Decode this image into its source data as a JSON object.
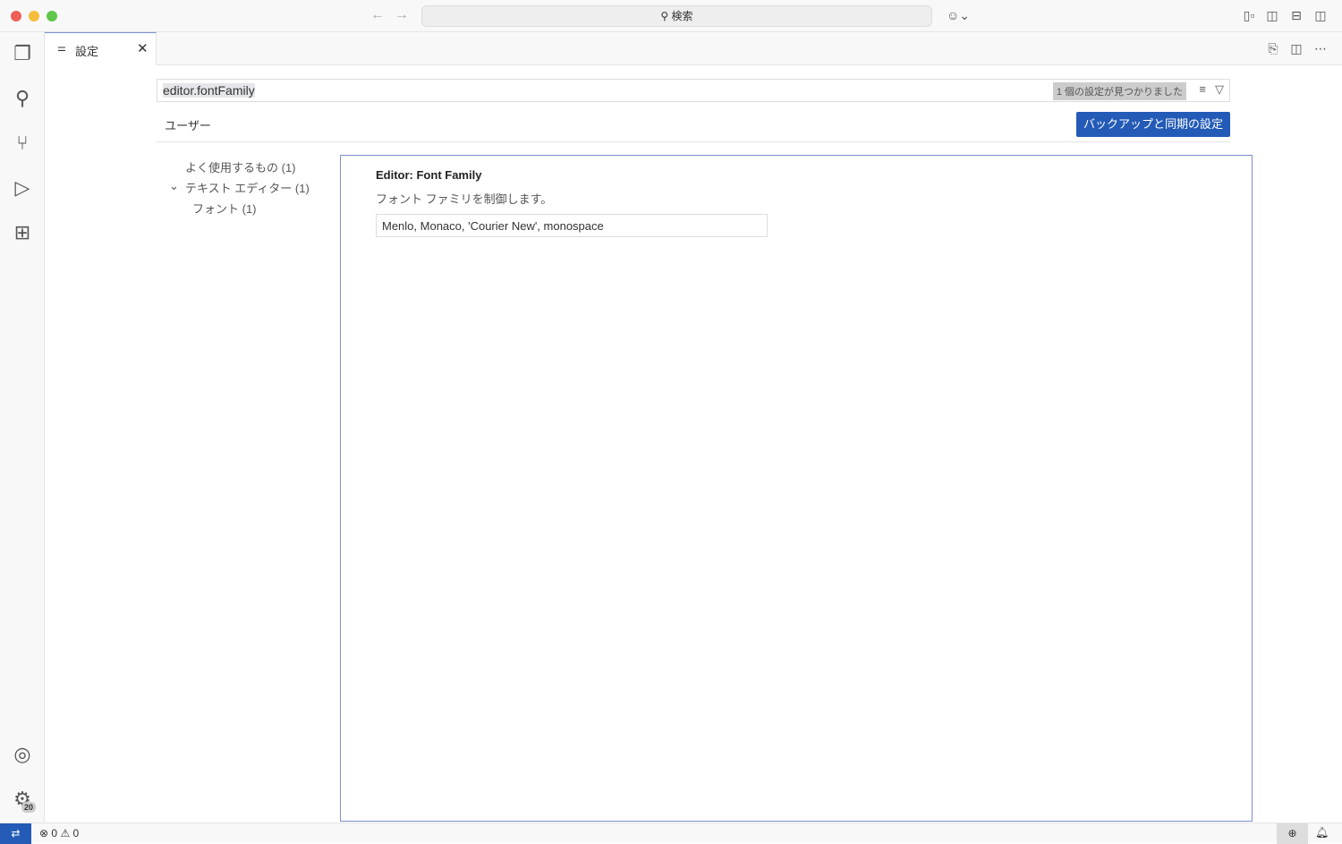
{
  "titlebar": {
    "search": "検索"
  },
  "tab": {
    "label": "設定"
  },
  "search": {
    "value": "editor.fontFamily",
    "result": "1 個の設定が見つかりました"
  },
  "backup_button": "バックアップと同期の設定",
  "scope_tab": "ユーザー",
  "toc": [
    "よく使用するもの (1)",
    "テキスト エディター (1)",
    "フォント (1)"
  ],
  "setting": {
    "title": "Editor: Font Family",
    "description": "フォント ファミリを制御します。",
    "value": "Menlo, Monaco, 'Courier New', monospace"
  },
  "activity": {
    "settings_badge": "20"
  },
  "status": {
    "errors": "0",
    "warnings": "0"
  }
}
